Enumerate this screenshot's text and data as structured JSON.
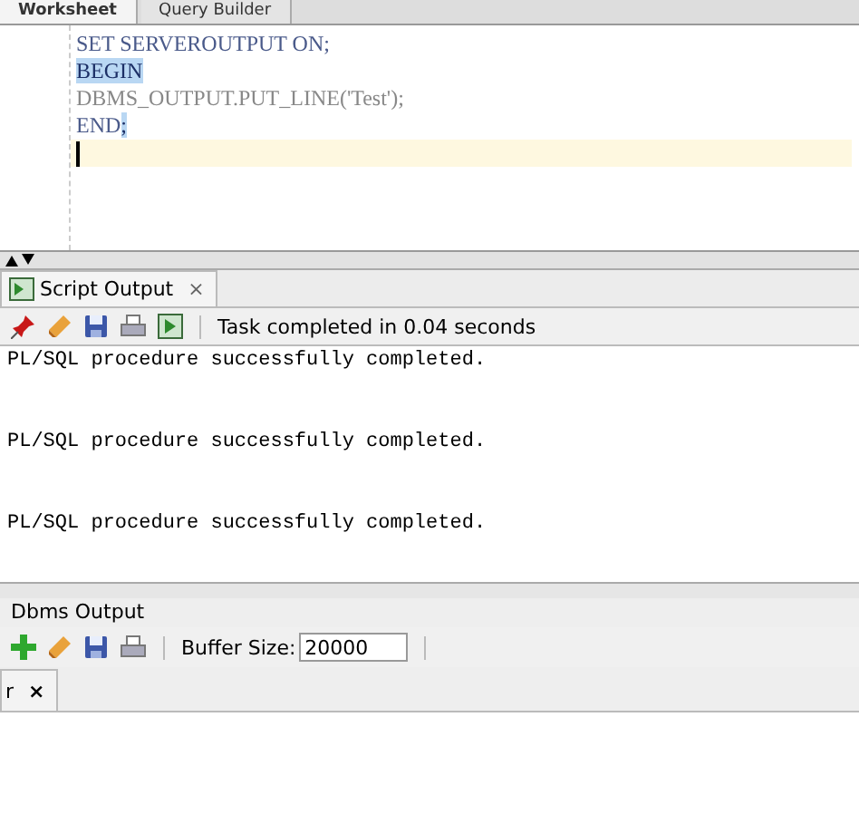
{
  "editor_tabs": [
    {
      "label": "Worksheet",
      "selected": true
    },
    {
      "label": "Query Builder",
      "selected": false
    }
  ],
  "editor": {
    "lines": [
      {
        "text": "SET SERVEROUTPUT ON;",
        "kind": "plain"
      },
      {
        "text": "BEGIN",
        "kind": "highlight"
      },
      {
        "text": "DBMS_OUTPUT.PUT_LINE('Test');",
        "kind": "dim"
      },
      {
        "text": "END;",
        "kind": "semihighlight"
      },
      {
        "kind": "caret"
      }
    ]
  },
  "script_output": {
    "tab": {
      "label": "Script Output",
      "close": "×"
    },
    "status": "Task completed in 0.04 seconds",
    "lines": [
      "PL/SQL procedure successfully completed.",
      "PL/SQL procedure successfully completed.",
      "PL/SQL procedure successfully completed."
    ]
  },
  "dbms_output": {
    "title": "Dbms Output",
    "buffer_label": "Buffer Size:",
    "buffer_value": "20000",
    "tab": {
      "label": "r",
      "close": "×"
    }
  }
}
